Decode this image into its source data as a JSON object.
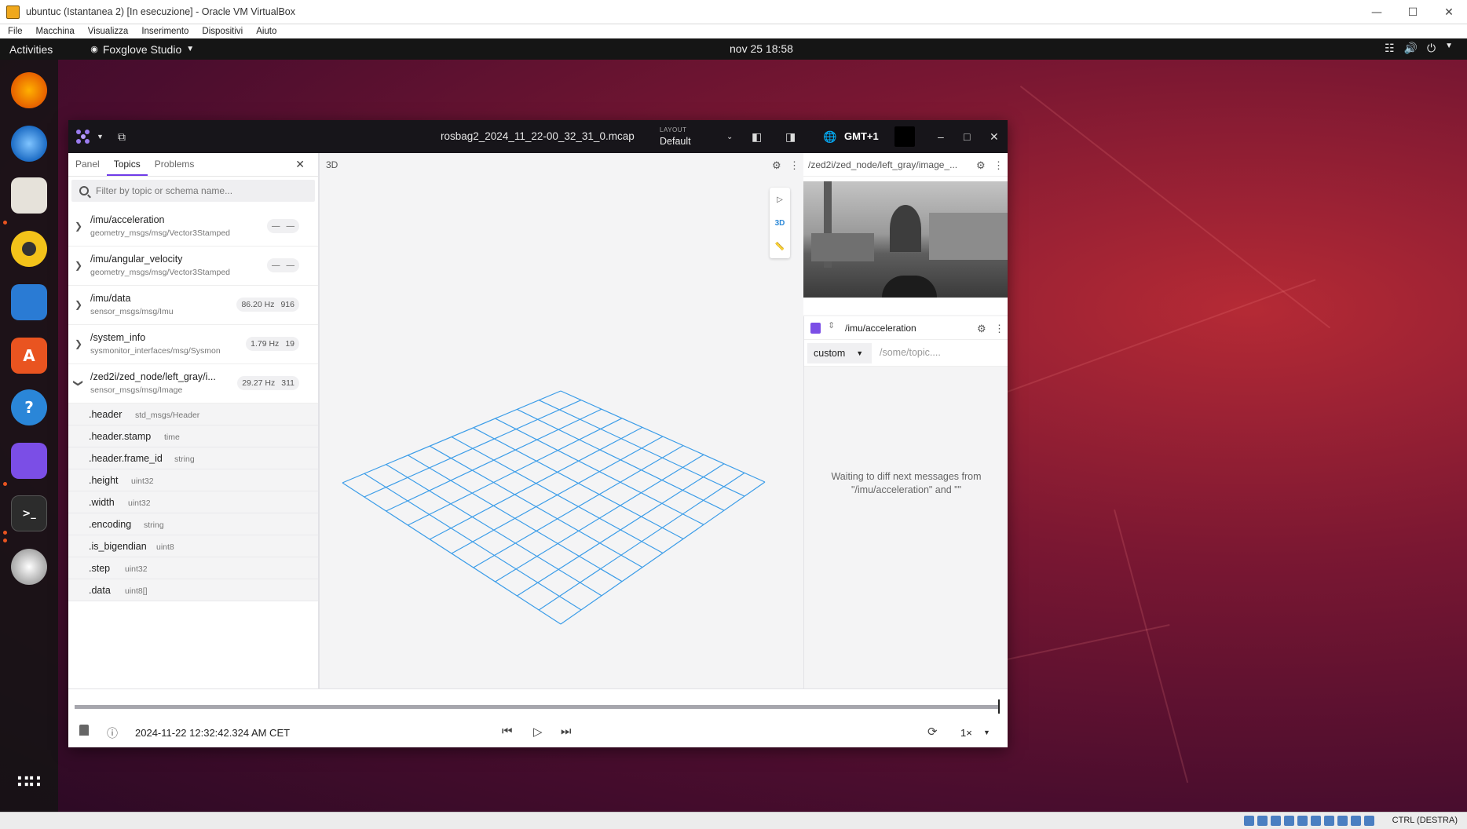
{
  "vbox": {
    "title": "ubuntuc (Istantanea 2) [In esecuzione] - Oracle VM VirtualBox",
    "menu": [
      "File",
      "Macchina",
      "Visualizza",
      "Inserimento",
      "Dispositivi",
      "Aiuto"
    ],
    "status_hotkey": "CTRL (DESTRA)"
  },
  "ubuntu": {
    "activities": "Activities",
    "app_name": "Foxglove Studio",
    "clock": "nov 25  18:58"
  },
  "foxglove": {
    "file": "rosbag2_2024_11_22-00_32_31_0.mcap",
    "layout_label": "LAYOUT",
    "layout_value": "Default",
    "timezone": "GMT+1",
    "sidebar": {
      "tabs": [
        "Panel",
        "Topics",
        "Problems"
      ],
      "filter_placeholder": "Filter by topic or schema name...",
      "topics": [
        {
          "name": "/imu/acceleration",
          "schema": "geometry_msgs/msg/Vector3Stamped",
          "hz": "—",
          "count": "—"
        },
        {
          "name": "/imu/angular_velocity",
          "schema": "geometry_msgs/msg/Vector3Stamped",
          "hz": "—",
          "count": "—"
        },
        {
          "name": "/imu/data",
          "schema": "sensor_msgs/msg/Imu",
          "hz": "86.20 Hz",
          "count": "916"
        },
        {
          "name": "/system_info",
          "schema": "sysmonitor_interfaces/msg/Sysmon",
          "hz": "1.79 Hz",
          "count": "19"
        },
        {
          "name": "/zed2i/zed_node/left_gray/i...",
          "schema": "sensor_msgs/msg/Image",
          "hz": "29.27 Hz",
          "count": "311"
        }
      ],
      "fields": [
        {
          "name": ".header",
          "type": "std_msgs/Header"
        },
        {
          "name": ".header.stamp",
          "type": "time"
        },
        {
          "name": ".header.frame_id",
          "type": "string"
        },
        {
          "name": ".height",
          "type": "uint32"
        },
        {
          "name": ".width",
          "type": "uint32"
        },
        {
          "name": ".encoding",
          "type": "string"
        },
        {
          "name": ".is_bigendian",
          "type": "uint8"
        },
        {
          "name": ".step",
          "type": "uint32"
        },
        {
          "name": ".data",
          "type": "uint8[]"
        }
      ]
    },
    "panel3d": {
      "title": "3D",
      "mode_label": "3D"
    },
    "image_panel": {
      "title": "/zed2i/zed_node/left_gray/image_..."
    },
    "diff_panel": {
      "topic": "/imu/acceleration",
      "select_value": "custom",
      "topic_placeholder": "/some/topic....",
      "waiting_line1": "Waiting to diff next messages from",
      "waiting_line2": "\"/imu/acceleration\" and \"\""
    },
    "playback": {
      "timestamp": "2024-11-22 12:32:42.324 AM CET",
      "speed": "1×",
      "progress": 1.0
    }
  }
}
